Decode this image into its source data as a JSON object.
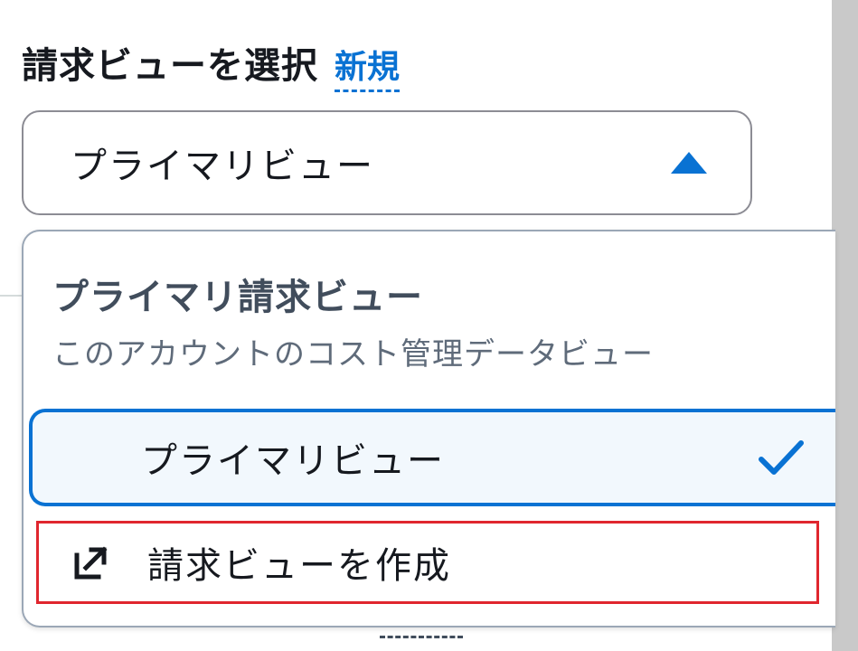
{
  "field": {
    "label": "請求ビューを選択",
    "new_link": "新規"
  },
  "select": {
    "value": "プライマリビュー",
    "expanded": true
  },
  "dropdown": {
    "group_title": "プライマリ請求ビュー",
    "group_description": "このアカウントのコスト管理データビュー",
    "options": [
      {
        "label": "プライマリビュー",
        "selected": true
      },
      {
        "label": "請求ビューを作成",
        "icon": "external-link-icon"
      }
    ]
  },
  "colors": {
    "accent": "#0972d3",
    "highlight_border": "#e0262e",
    "selected_bg": "#f2f8fd"
  }
}
